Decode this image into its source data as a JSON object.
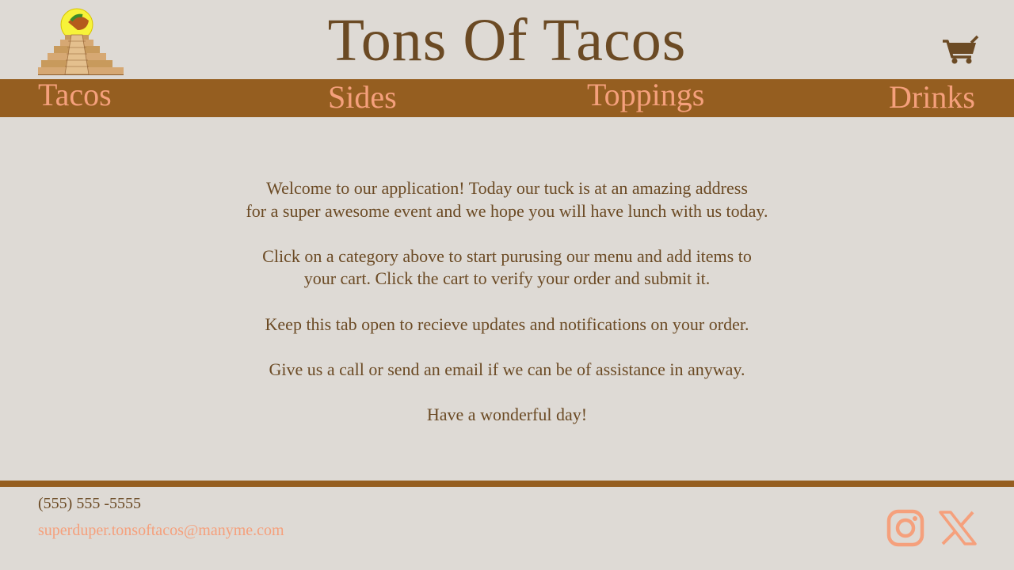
{
  "header": {
    "title": "Tons Of Tacos",
    "logo_icon": "pyramid-taco-logo",
    "cart_icon": "cart-icon"
  },
  "nav": {
    "items": [
      {
        "label": "Tacos"
      },
      {
        "label": "Sides"
      },
      {
        "label": "Toppings"
      },
      {
        "label": "Drinks"
      }
    ]
  },
  "main": {
    "paragraphs": [
      "Welcome to our application! Today our tuck is at an amazing address\nfor a super awesome event and we hope you will have lunch with us today.",
      "Click on a category above to start purusing our menu and add items to\nyour cart. Click the cart to verify your order and submit it.",
      "Keep this tab open to recieve updates and notifications on your order.",
      "Give us a call or send an email if we can be of assistance in anyway.",
      "Have a wonderful day!"
    ]
  },
  "footer": {
    "phone": "(555) 555 -5555",
    "email": "superduper.tonsoftacos@manyme.com",
    "social": [
      "instagram-icon",
      "x-icon"
    ]
  },
  "colors": {
    "background": "#dedad5",
    "brand_brown": "#955e20",
    "text_brown": "#6b4a24",
    "accent_salmon": "#f5a07c"
  }
}
